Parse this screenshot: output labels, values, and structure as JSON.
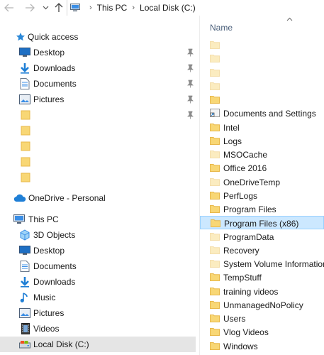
{
  "address": {
    "segments": [
      "This PC",
      "Local Disk (C:)"
    ]
  },
  "navigation": {
    "quick_access": {
      "label": "Quick access",
      "items": [
        {
          "label": "Desktop",
          "icon": "desktop-icon",
          "pinned": true
        },
        {
          "label": "Downloads",
          "icon": "downloads-icon",
          "pinned": true
        },
        {
          "label": "Documents",
          "icon": "documents-icon",
          "pinned": true
        },
        {
          "label": "Pictures",
          "icon": "pictures-icon",
          "pinned": true
        },
        {
          "label": "",
          "icon": "folder-icon",
          "pinned": true
        },
        {
          "label": "",
          "icon": "folder-icon",
          "pinned": false
        },
        {
          "label": "",
          "icon": "folder-icon",
          "pinned": false
        },
        {
          "label": "",
          "icon": "folder-icon",
          "pinned": false
        },
        {
          "label": "",
          "icon": "folder-icon",
          "pinned": false
        }
      ]
    },
    "onedrive": {
      "label": "OneDrive - Personal"
    },
    "this_pc": {
      "label": "This PC",
      "items": [
        {
          "label": "3D Objects",
          "icon": "3d-objects-icon"
        },
        {
          "label": "Desktop",
          "icon": "desktop-icon"
        },
        {
          "label": "Documents",
          "icon": "documents-icon"
        },
        {
          "label": "Downloads",
          "icon": "downloads-icon"
        },
        {
          "label": "Music",
          "icon": "music-icon"
        },
        {
          "label": "Pictures",
          "icon": "pictures-icon"
        },
        {
          "label": "Videos",
          "icon": "videos-icon"
        },
        {
          "label": "Local Disk (C:)",
          "icon": "drive-icon",
          "selected": true
        }
      ]
    }
  },
  "file_list": {
    "column_header": "Name",
    "items": [
      {
        "name": "",
        "icon": "folder-icon",
        "faded": true
      },
      {
        "name": "",
        "icon": "folder-icon",
        "faded": true
      },
      {
        "name": "",
        "icon": "folder-icon",
        "faded": true
      },
      {
        "name": "",
        "icon": "folder-icon",
        "faded": true
      },
      {
        "name": "",
        "icon": "folder-icon",
        "faded": false
      },
      {
        "name": "Documents and Settings",
        "icon": "shortcut-folder-icon",
        "faded": false
      },
      {
        "name": "Intel",
        "icon": "folder-icon",
        "faded": false
      },
      {
        "name": "Logs",
        "icon": "folder-icon",
        "faded": false
      },
      {
        "name": "MSOCache",
        "icon": "folder-icon",
        "faded": true
      },
      {
        "name": "Office 2016",
        "icon": "folder-icon",
        "faded": false
      },
      {
        "name": "OneDriveTemp",
        "icon": "folder-icon",
        "faded": true
      },
      {
        "name": "PerfLogs",
        "icon": "folder-icon",
        "faded": false
      },
      {
        "name": "Program Files",
        "icon": "folder-icon",
        "faded": false
      },
      {
        "name": "Program Files (x86)",
        "icon": "folder-icon",
        "faded": false,
        "selected": true
      },
      {
        "name": "ProgramData",
        "icon": "folder-icon",
        "faded": true
      },
      {
        "name": "Recovery",
        "icon": "folder-icon",
        "faded": true
      },
      {
        "name": "System Volume Information",
        "icon": "folder-icon",
        "faded": true
      },
      {
        "name": "TempStuff",
        "icon": "folder-icon",
        "faded": false
      },
      {
        "name": "training videos",
        "icon": "folder-icon",
        "faded": false
      },
      {
        "name": "UnmanagedNoPolicy",
        "icon": "folder-icon",
        "faded": false
      },
      {
        "name": "Users",
        "icon": "folder-icon",
        "faded": false
      },
      {
        "name": "Vlog Videos",
        "icon": "folder-icon",
        "faded": false
      },
      {
        "name": "Windows",
        "icon": "folder-icon",
        "faded": false
      }
    ]
  },
  "colors": {
    "folder": "#f8d775",
    "folder_dark": "#e8b84a",
    "selection_bg": "#cce8ff",
    "selection_border": "#99d1ff",
    "nav_selected": "#e5e5e5",
    "header_text": "#4a5f7a",
    "accent_blue": "#1f7fd6"
  }
}
